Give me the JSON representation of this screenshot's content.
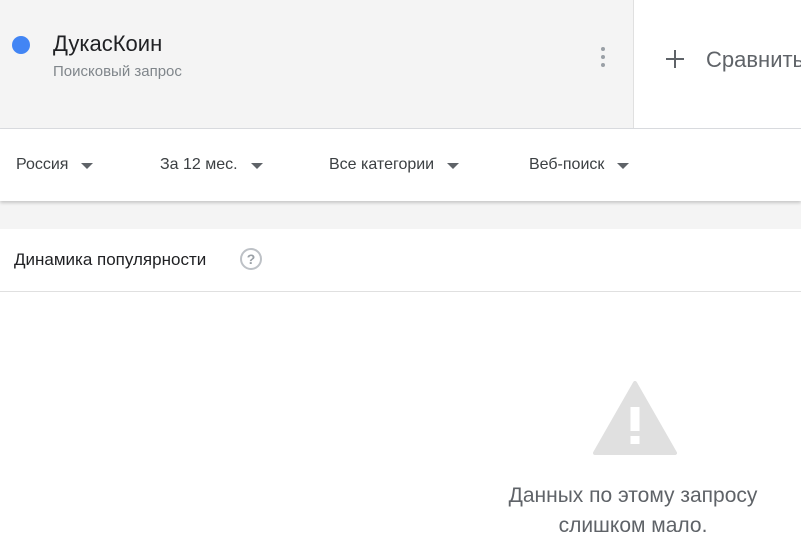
{
  "term": {
    "name": "ДукасКоин",
    "subtitle": "Поисковый запрос",
    "color": "#4285f4"
  },
  "compare": {
    "label": "Сравнить"
  },
  "filters": {
    "region": "Россия",
    "period": "За 12 мес.",
    "category": "Все категории",
    "search_type": "Веб-поиск"
  },
  "interest_card": {
    "title": "Динамика популярности",
    "help_glyph": "?",
    "empty_message_line1": "Данных по этому запросу",
    "empty_message_line2": "слишком мало."
  },
  "icons": {
    "more": "more-vert-icon",
    "plus": "plus-icon",
    "caret": "caret-down-icon",
    "help": "help-icon",
    "warning": "warning-icon"
  }
}
